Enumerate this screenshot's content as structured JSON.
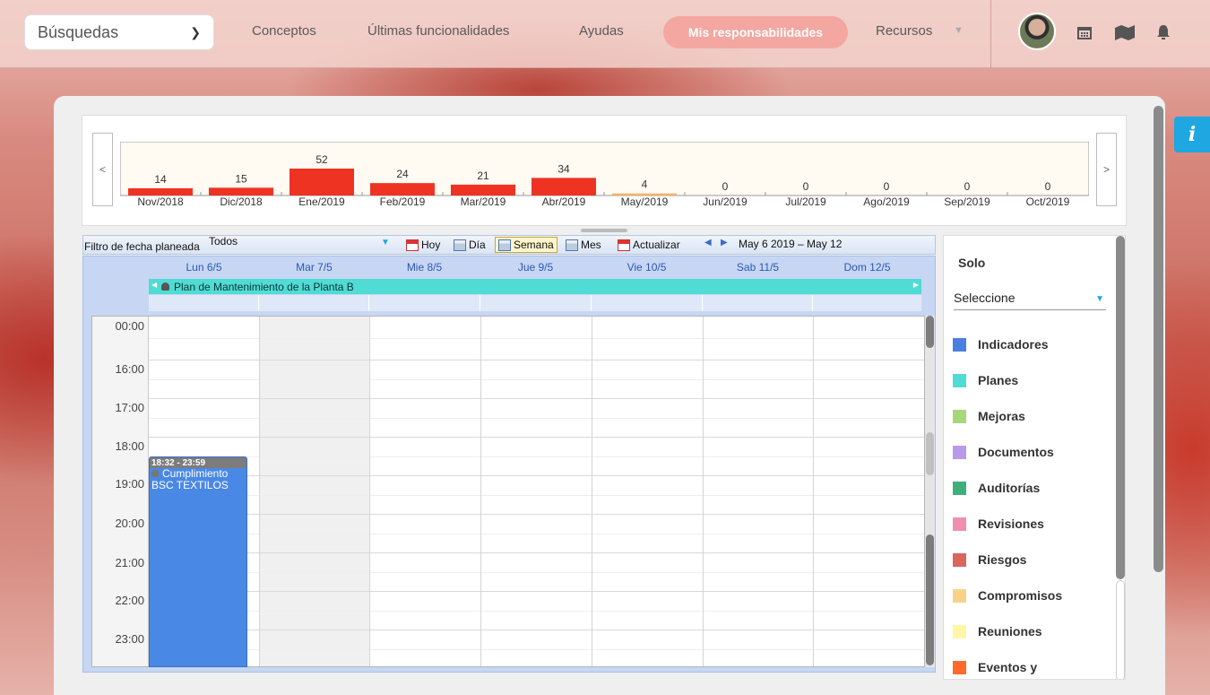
{
  "nav": {
    "search_select": "Búsquedas",
    "items": [
      "Conceptos",
      "Últimas funcionalidades",
      "Ayudas",
      "Mis responsabilidades",
      "Recursos"
    ]
  },
  "info_button": "i",
  "chart_nav": {
    "prev": "<",
    "next": ">"
  },
  "chart_data": {
    "type": "bar",
    "categories": [
      "Nov/2018",
      "Dic/2018",
      "Ene/2019",
      "Feb/2019",
      "Mar/2019",
      "Abr/2019",
      "May/2019",
      "Jun/2019",
      "Jul/2019",
      "Ago/2019",
      "Sep/2019",
      "Oct/2019"
    ],
    "values": [
      14,
      15,
      52,
      24,
      21,
      34,
      4,
      0,
      0,
      0,
      0,
      0
    ],
    "highlight_category": "May/2019",
    "bar_color": "#ee3322",
    "highlight_color": "#f5b26b",
    "grid": false
  },
  "toolbar": {
    "filter_label": "Filtro de fecha planeada",
    "filter_value": "Todos",
    "hoy": "Hoy",
    "dia": "Día",
    "semana": "Semana",
    "mes": "Mes",
    "actualizar": "Actualizar",
    "range": "May 6 2019 – May 12"
  },
  "calendar": {
    "days": [
      "Lun 6/5",
      "Mar 7/5",
      "Mie 8/5",
      "Jue 9/5",
      "Vie 10/5",
      "Sab 11/5",
      "Dom 12/5"
    ],
    "allday_event": "Plan de Mantenimiento de la Planta B",
    "hours": [
      "00:00",
      "16:00",
      "17:00",
      "18:00",
      "19:00",
      "20:00",
      "21:00",
      "22:00",
      "23:00"
    ],
    "event": {
      "time": "18:32 - 23:59",
      "line1": "Cumplimiento",
      "line2": "BSC TEXTILOS"
    }
  },
  "side": {
    "title": "Solo",
    "select_value": "Seleccione",
    "legend": [
      {
        "label": "Indicadores",
        "color": "#4a7fe0"
      },
      {
        "label": "Planes",
        "color": "#4fdcd5"
      },
      {
        "label": "Mejoras",
        "color": "#a8d77a"
      },
      {
        "label": "Documentos",
        "color": "#b79be8"
      },
      {
        "label": "Auditorías",
        "color": "#3fb07c"
      },
      {
        "label": "Revisiones",
        "color": "#f08fb0"
      },
      {
        "label": "Riesgos",
        "color": "#d9665f"
      },
      {
        "label": "Compromisos",
        "color": "#f8d387"
      },
      {
        "label": "Reuniones",
        "color": "#fdf7a6"
      },
      {
        "label": "Eventos y",
        "color": "#ff6a2a"
      }
    ]
  }
}
